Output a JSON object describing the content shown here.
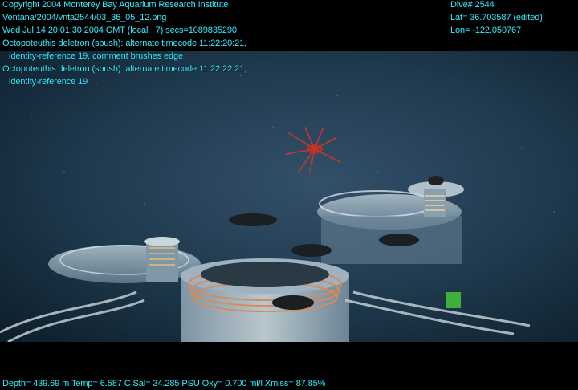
{
  "overlay": {
    "left_lines": [
      "Copyright 2004 Monterey Bay Aquarium Research Institute",
      "Ventana/2004/vnta2544/03_36_05_12.png",
      "Wed Jul 14 20:01:30 2004 GMT (local +7)  secs=1089835290",
      "Octopoteuthis deletron (sbush): alternate timecode 11:22:20:21,",
      "identity-reference 19, comment brushes edge",
      "Octopoteuthis deletron (sbush): alternate timecode 11:22:22:21,",
      "identity-reference 19"
    ],
    "right_lines": [
      "Dive# 2544",
      "Lat= 36.703587 (edited)",
      "Lon= -122.050767"
    ],
    "bottom_line": "Depth= 439.69 m  Temp= 6.587 C  Sal= 34.285 PSU  Oxy= 0.700 ml/l  Xmiss= 87.85%"
  },
  "colors": {
    "overlay_text": "#33eeff",
    "water_deep": "#0e1f2c",
    "water_light": "#2f4a5e",
    "organism": "#c0392b"
  }
}
